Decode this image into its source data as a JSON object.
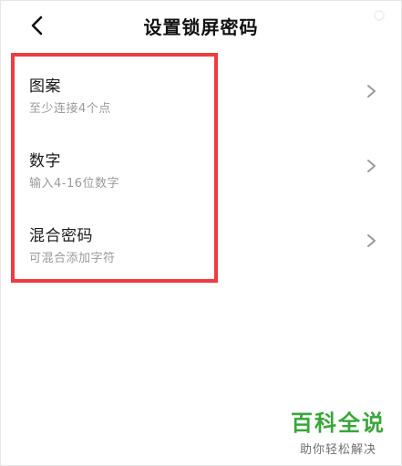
{
  "header": {
    "title": "设置锁屏密码",
    "back_icon": "chevron-left-icon"
  },
  "options": [
    {
      "title": "图案",
      "subtitle": "至少连接4个点",
      "icon": "chevron-right-icon"
    },
    {
      "title": "数字",
      "subtitle": "输入4-16位数字",
      "icon": "chevron-right-icon"
    },
    {
      "title": "混合密码",
      "subtitle": "可混合添加字符",
      "icon": "chevron-right-icon"
    }
  ],
  "annotation": {
    "color": "#ef3b3f"
  },
  "watermark": {
    "main": "百科全说",
    "sub": "助你轻松解决",
    "color": "#3aa53a"
  }
}
